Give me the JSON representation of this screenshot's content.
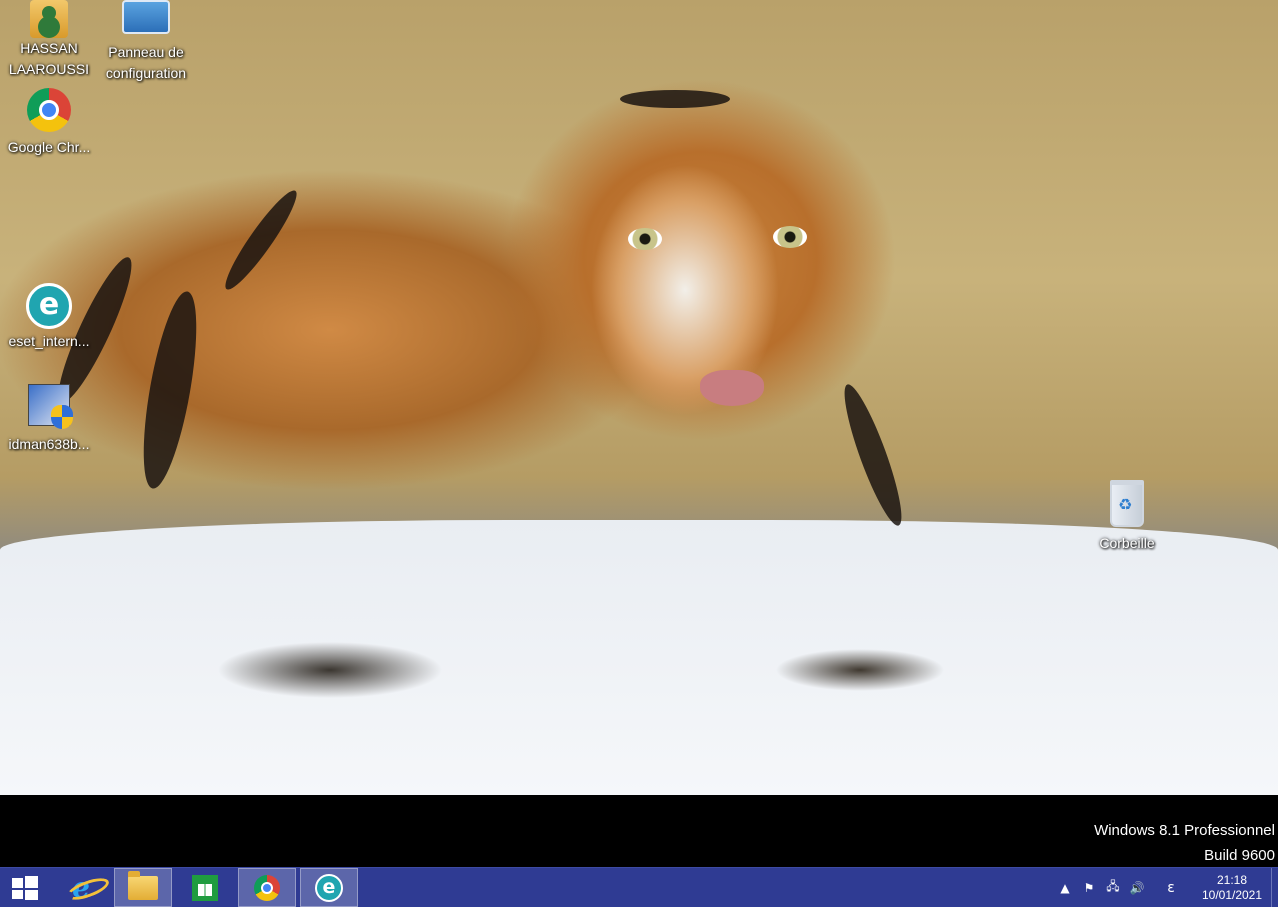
{
  "desktop": {
    "icons": [
      {
        "label": "HASSAN LAAROUSSI",
        "icon": "user-folder-icon"
      },
      {
        "label": "Panneau de configuration",
        "icon": "control-panel-icon"
      },
      {
        "label": "Google Chr...",
        "icon": "chrome-icon"
      },
      {
        "label": "eset_intern...",
        "icon": "eset-icon"
      },
      {
        "label": "idman638b...",
        "icon": "idm-installer-icon"
      },
      {
        "label": "Corbeille",
        "icon": "recycle-bin-icon"
      }
    ]
  },
  "watermark": {
    "line1": "Windows 8.1 Professionnel",
    "line2": "Build 9600"
  },
  "taskbar": {
    "color": "#2f3b93",
    "apps": [
      {
        "name": "start",
        "icon": "windows-logo-icon"
      },
      {
        "name": "internet-explorer",
        "icon": "internet-explorer-icon"
      },
      {
        "name": "file-explorer",
        "icon": "folder-icon"
      },
      {
        "name": "store",
        "icon": "store-icon"
      },
      {
        "name": "chrome",
        "icon": "chrome-icon"
      },
      {
        "name": "eset",
        "icon": "eset-icon"
      }
    ],
    "tray": {
      "input_indicator": "ε",
      "time": "21:18",
      "date": "10/01/2021"
    }
  }
}
